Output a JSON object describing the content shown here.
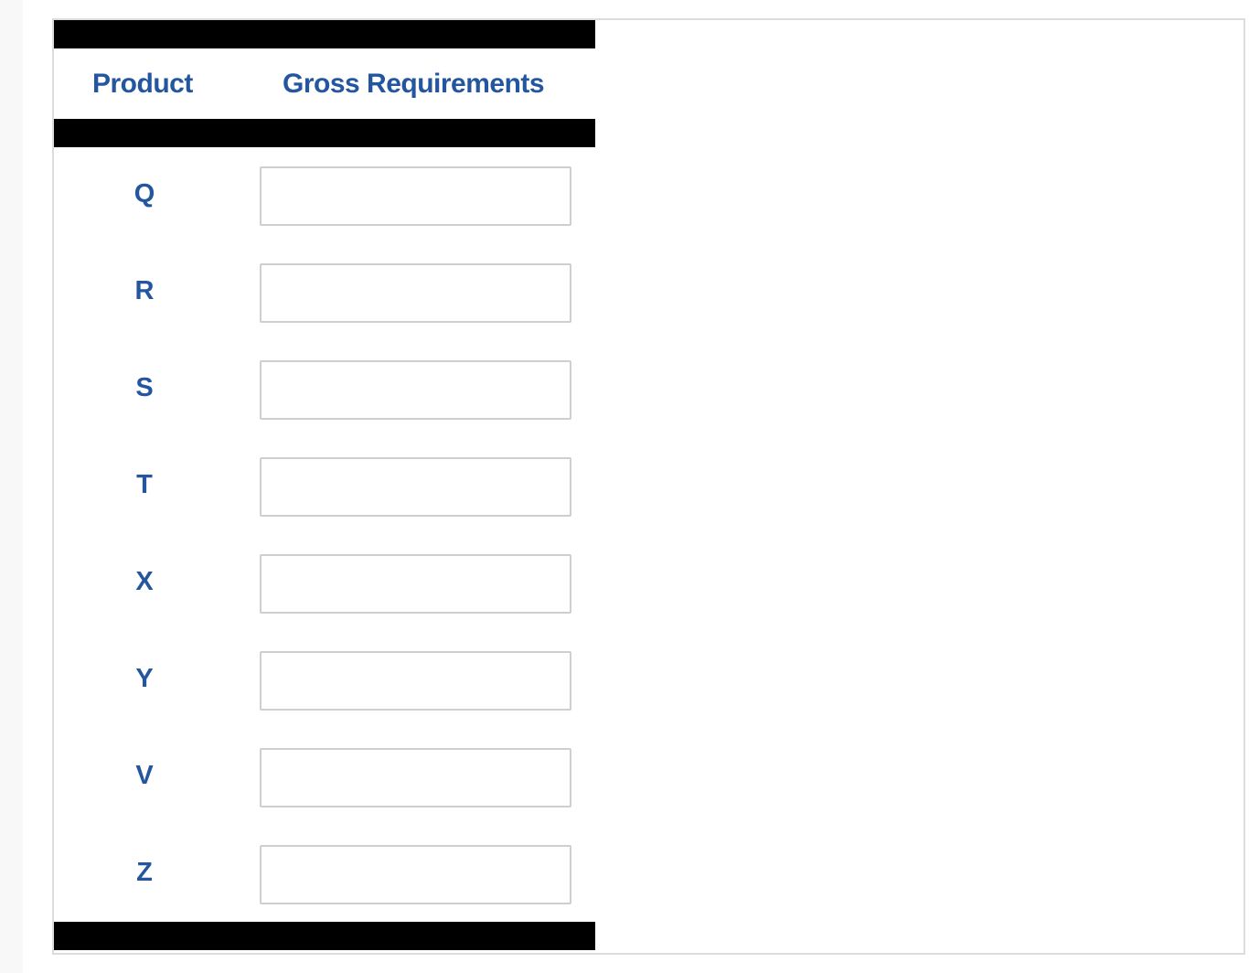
{
  "table": {
    "headers": {
      "product": "Product",
      "gross_requirements": "Gross Requirements"
    },
    "rows": [
      {
        "product": "Q",
        "gross_requirements": ""
      },
      {
        "product": "R",
        "gross_requirements": ""
      },
      {
        "product": "S",
        "gross_requirements": ""
      },
      {
        "product": "T",
        "gross_requirements": ""
      },
      {
        "product": "X",
        "gross_requirements": ""
      },
      {
        "product": "Y",
        "gross_requirements": ""
      },
      {
        "product": "V",
        "gross_requirements": ""
      },
      {
        "product": "Z",
        "gross_requirements": ""
      }
    ]
  },
  "colors": {
    "header_text": "#2456a0",
    "bar": "#000000",
    "input_border": "#cfcfcf"
  }
}
